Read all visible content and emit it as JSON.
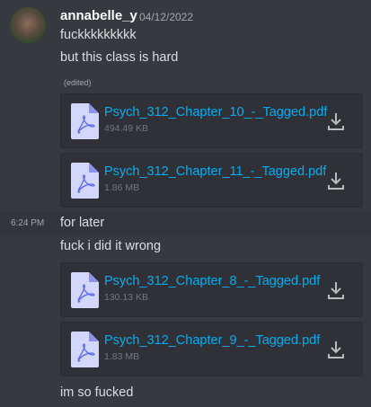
{
  "author": {
    "name": "annabelle_y",
    "date": "04/12/2022"
  },
  "messages": [
    {
      "text": "fuckkkkkkkkk"
    },
    {
      "text": "but this class is hard",
      "edited": "(edited)"
    },
    {
      "text": "for later",
      "time": "6:24 PM"
    },
    {
      "text": "fuck i did it wrong"
    },
    {
      "text": "im so fucked"
    }
  ],
  "attachments": [
    {
      "name": "Psych_312_Chapter_10_-_Tagged.pdf",
      "size": "494.49 KB"
    },
    {
      "name": "Psych_312_Chapter_11_-_Tagged.pdf",
      "size": "1.86 MB"
    },
    {
      "name": "Psych_312_Chapter_8_-_Tagged.pdf",
      "size": "130.13 KB"
    },
    {
      "name": "Psych_312_Chapter_9_-_Tagged.pdf",
      "size": "1.83 MB"
    }
  ],
  "colors": {
    "link": "#00aff4",
    "background": "#36393f"
  }
}
